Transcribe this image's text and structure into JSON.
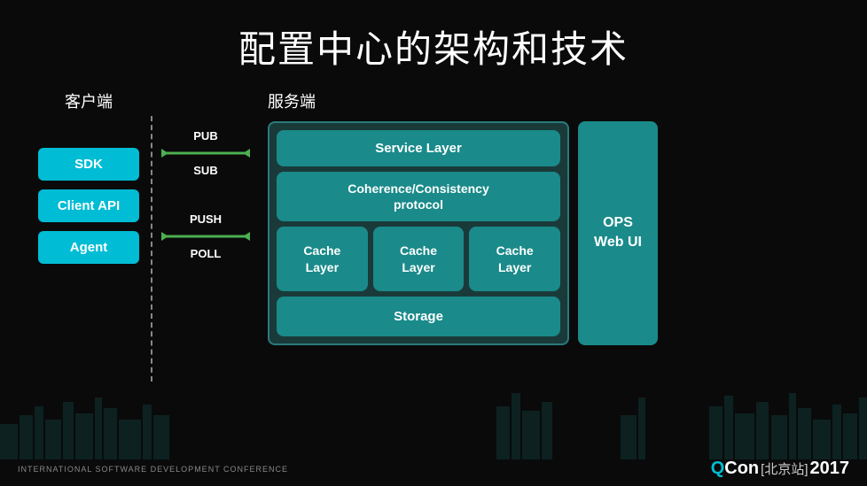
{
  "title": "配置中心的架构和技术",
  "client": {
    "label": "客户端",
    "boxes": [
      "SDK",
      "Client API",
      "Agent"
    ]
  },
  "server": {
    "label": "服务端"
  },
  "arrows": {
    "pub": "PUB",
    "sub": "SUB",
    "push": "PUSH",
    "poll": "POLL"
  },
  "architecture": {
    "service_layer": "Service Layer",
    "coherence": "Coherence/Consistency\nprotocol",
    "cache_layers": [
      "Cache\nLayer",
      "Cache\nLayer",
      "Cache\nLayer"
    ],
    "storage": "Storage",
    "ops": "OPS\nWeb UI"
  },
  "footer": {
    "left": "INTERNATIONAL SOFTWARE DEVELOPMENT CONFERENCE",
    "brand": "QCon",
    "location": "[北京站]",
    "year": "2017"
  }
}
